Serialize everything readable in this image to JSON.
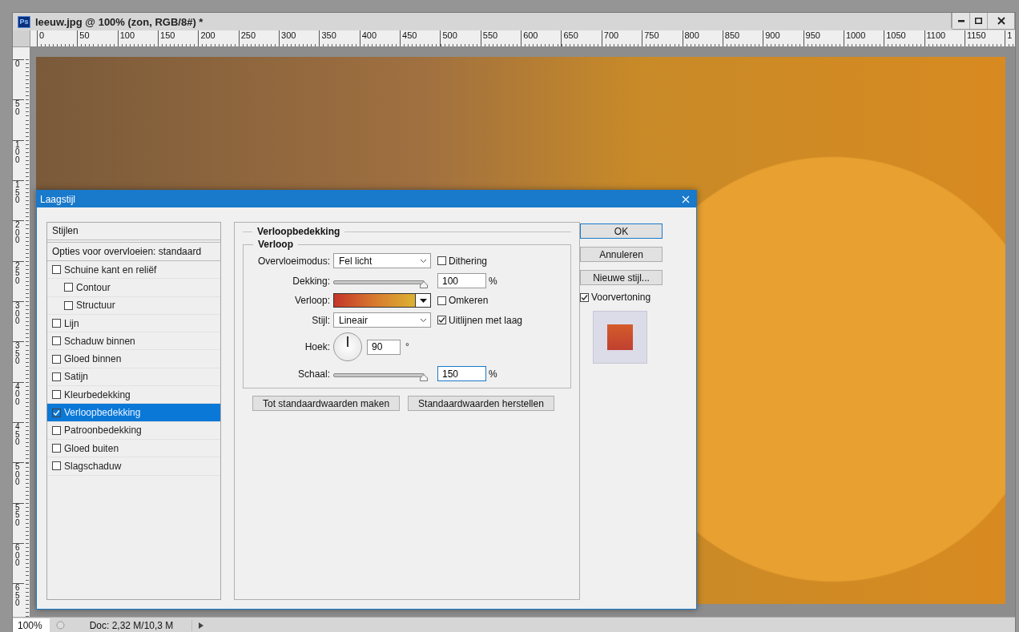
{
  "window": {
    "app_badge": "Ps",
    "title": "leeuw.jpg @ 100% (zon, RGB/8#) *"
  },
  "rulers": {
    "horizontal": [
      "0",
      "50",
      "100",
      "150",
      "200",
      "250",
      "300",
      "350",
      "400",
      "450",
      "500",
      "550",
      "600",
      "650",
      "700",
      "750",
      "800",
      "850",
      "900",
      "950",
      "1000",
      "1050",
      "1100",
      "1150",
      "1"
    ],
    "vertical": [
      "0",
      "50",
      "100",
      "150",
      "200",
      "250",
      "300",
      "350",
      "400",
      "450",
      "500",
      "550",
      "600",
      "650"
    ]
  },
  "dialog": {
    "title": "Laagstijl",
    "styles_header": "Stijlen",
    "blend_options": "Opties voor overvloeien: standaard",
    "styles": [
      {
        "label": "Schuine kant en reliëf",
        "checked": false,
        "selected": false,
        "children": [
          {
            "label": "Contour",
            "checked": false,
            "selected": false
          },
          {
            "label": "Structuur",
            "checked": false,
            "selected": false
          }
        ]
      },
      {
        "label": "Lijn",
        "checked": false,
        "selected": false
      },
      {
        "label": "Schaduw binnen",
        "checked": false,
        "selected": false
      },
      {
        "label": "Gloed binnen",
        "checked": false,
        "selected": false
      },
      {
        "label": "Satijn",
        "checked": false,
        "selected": false
      },
      {
        "label": "Kleurbedekking",
        "checked": false,
        "selected": false
      },
      {
        "label": "Verloopbedekking",
        "checked": true,
        "selected": true
      },
      {
        "label": "Patroonbedekking",
        "checked": false,
        "selected": false
      },
      {
        "label": "Gloed buiten",
        "checked": false,
        "selected": false
      },
      {
        "label": "Slagschaduw",
        "checked": false,
        "selected": false
      }
    ],
    "section_title": "Verloopbedekking",
    "group_title": "Verloop",
    "blend_mode": {
      "label": "Overvloeimodus:",
      "value": "Fel licht"
    },
    "dithering": {
      "label": "Dithering",
      "checked": false
    },
    "opacity": {
      "label": "Dekking:",
      "level": 1,
      "value": "100",
      "unit": "%",
      "focused": false
    },
    "gradient": {
      "label": "Verloop:"
    },
    "reverse": {
      "label": "Omkeren",
      "checked": false
    },
    "style": {
      "label": "Stijl:",
      "value": "Lineair"
    },
    "align": {
      "label": "Uitlijnen met laag",
      "checked": true
    },
    "angle": {
      "label": "Hoek:",
      "value": "90",
      "unit": "°"
    },
    "scale": {
      "label": "Schaal:",
      "level": 1,
      "value": "150",
      "unit": "%",
      "focused": true
    },
    "reset_buttons": [
      "Tot standaardwaarden maken",
      "Standaardwaarden herstellen"
    ],
    "buttons": [
      {
        "label": "OK",
        "kind": "default"
      },
      {
        "label": "Annuleren",
        "kind": "normal"
      },
      {
        "label": "Nieuwe stijl...",
        "kind": "normal"
      }
    ],
    "preview": {
      "label": "Voorvertoning",
      "checked": true
    }
  },
  "status_bar": {
    "zoom": "100%",
    "doc": "Doc: 2,32 M/10,3 M"
  }
}
